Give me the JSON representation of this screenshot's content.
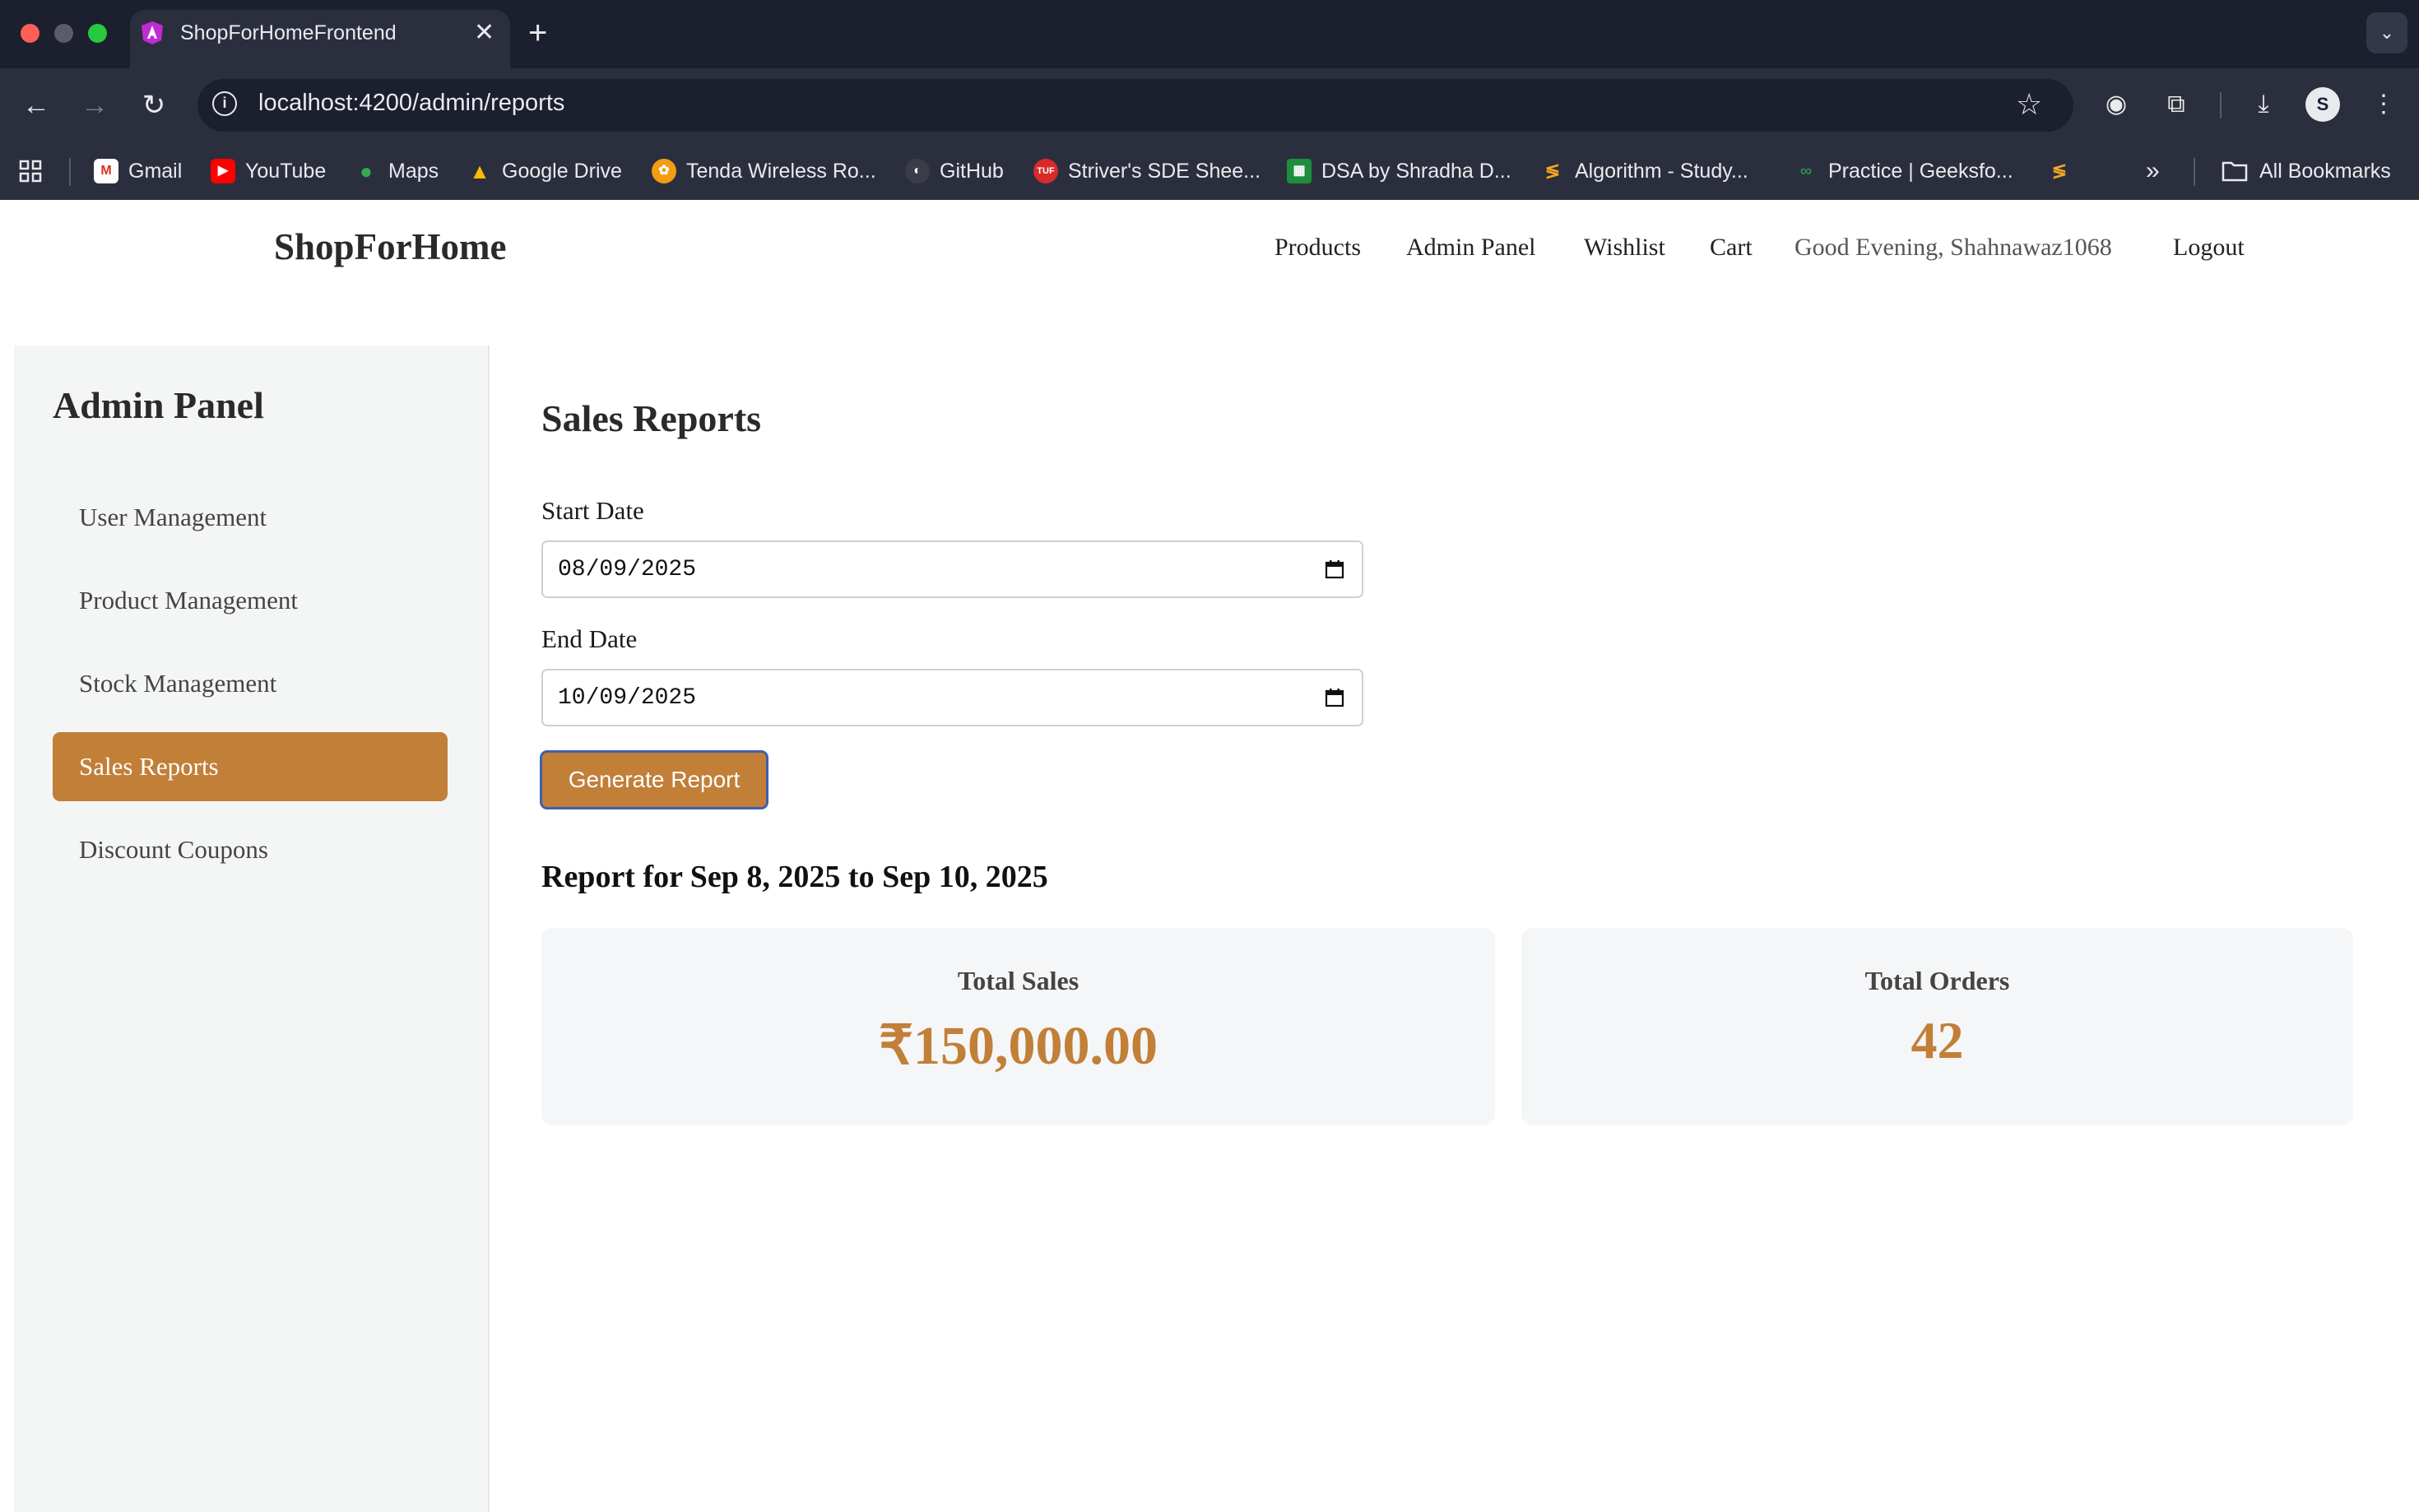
{
  "browser": {
    "tab_title": "ShopForHomeFrontend",
    "tab_close": "✕",
    "new_tab": "+",
    "url": "localhost:4200/admin/reports",
    "bookmarks": [
      "Gmail",
      "YouTube",
      "Maps",
      "Google Drive",
      "Tenda Wireless Ro...",
      "GitHub",
      "Striver's SDE Shee...",
      "DSA by Shradha D...",
      "Algorithm - Study...",
      "Practice | Geeksfo..."
    ],
    "more_bookmarks": "»",
    "all_bookmarks": "All Bookmarks",
    "profile_initial": "S"
  },
  "header": {
    "brand": "ShopForHome",
    "nav": [
      "Products",
      "Admin Panel",
      "Wishlist",
      "Cart"
    ],
    "greeting": "Good Evening, Shahnawaz1068",
    "logout": "Logout"
  },
  "sidebar": {
    "title": "Admin Panel",
    "items": [
      "User Management",
      "Product Management",
      "Stock Management",
      "Sales Reports",
      "Discount Coupons"
    ],
    "active": "Sales Reports"
  },
  "main": {
    "title": "Sales Reports",
    "start_label": "Start Date",
    "start_value": "08/09/2025",
    "end_label": "End Date",
    "end_value": "10/09/2025",
    "generate_label": "Generate Report",
    "report_heading": "Report for Sep 8, 2025 to Sep 10, 2025",
    "total_sales_label": "Total Sales",
    "total_sales_value": "₹150,000.00",
    "total_orders_label": "Total Orders",
    "total_orders_value": "42"
  },
  "colors": {
    "accent": "#c17f38",
    "chrome_dark": "#1c1f2e",
    "chrome": "#2b2f3d"
  }
}
